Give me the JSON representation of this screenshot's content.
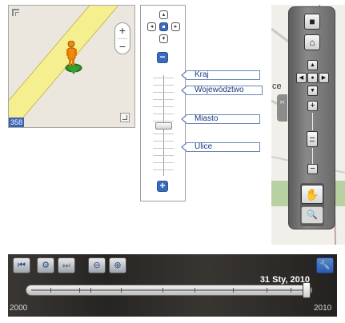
{
  "mini_map": {
    "scale_label": "358",
    "zoom_in": "+",
    "zoom_out": "−"
  },
  "nav_panel": {
    "zoom_in": "+",
    "zoom_out": "−",
    "levels": [
      "Kraj",
      "Województwo",
      "Miasto",
      "Ulice"
    ]
  },
  "right_map": {
    "label": "ce",
    "side_tab": "›‹"
  },
  "timeline": {
    "date": "31 Sty, 2010",
    "start_year": "2000",
    "end_year": "2010",
    "position": 1.0
  },
  "colors": {
    "accent": "#3b6abb",
    "road_fill": "#f6ef8f",
    "road_edge": "#c9b85d",
    "pegman": "#f08a0c",
    "park": "#b7d1a3"
  }
}
